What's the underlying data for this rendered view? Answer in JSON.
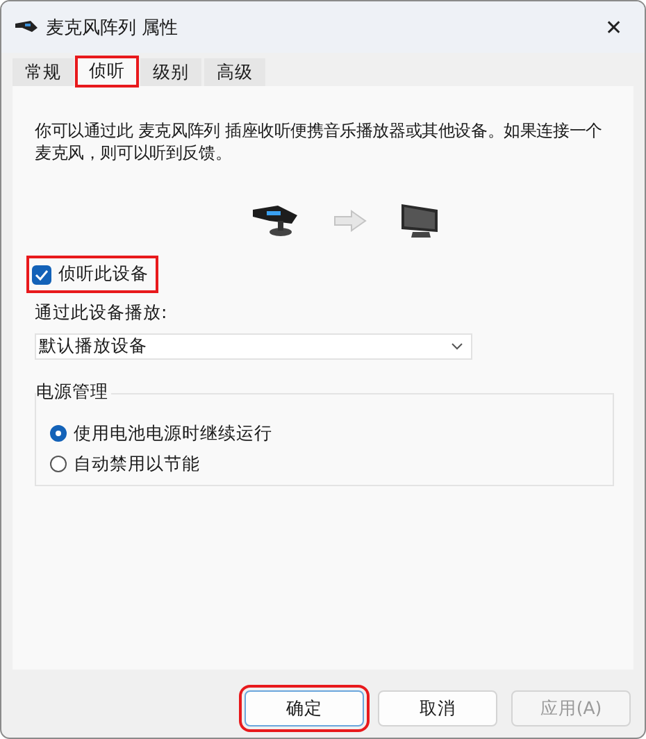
{
  "window": {
    "title": "麦克风阵列 属性",
    "close": "✕"
  },
  "tabs": [
    {
      "label": "常规",
      "selected": false,
      "highlighted": false
    },
    {
      "label": "侦听",
      "selected": true,
      "highlighted": true
    },
    {
      "label": "级别",
      "selected": false,
      "highlighted": false
    },
    {
      "label": "高级",
      "selected": false,
      "highlighted": false
    }
  ],
  "description": "你可以通过此 麦克风阵列 插座收听便携音乐播放器或其他设备。如果连接一个麦克风，则可以听到反馈。",
  "listen_checkbox": {
    "label": "侦听此设备",
    "checked": true,
    "highlighted": true
  },
  "playback_label": "通过此设备播放:",
  "playback_dropdown": {
    "value": "默认播放设备"
  },
  "power_group": {
    "title": "电源管理",
    "options": [
      {
        "label": "使用电池电源时继续运行",
        "selected": true
      },
      {
        "label": "自动禁用以节能",
        "selected": false
      }
    ]
  },
  "buttons": [
    {
      "label": "确定",
      "disabled": false,
      "highlighted": true,
      "default": true
    },
    {
      "label": "取消",
      "disabled": false,
      "highlighted": false,
      "default": false
    },
    {
      "label": "应用(A)",
      "disabled": true,
      "highlighted": false,
      "default": false
    }
  ]
}
